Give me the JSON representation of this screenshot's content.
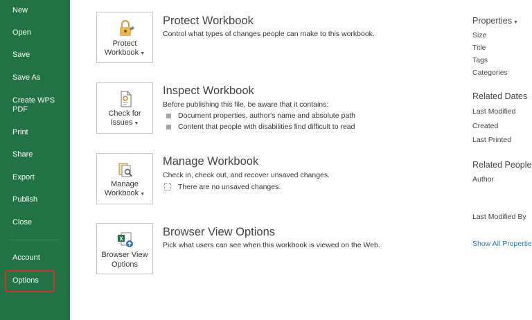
{
  "sidebar": {
    "items": [
      {
        "label": "New"
      },
      {
        "label": "Open"
      },
      {
        "label": "Save"
      },
      {
        "label": "Save As"
      },
      {
        "label": "Create WPS PDF"
      },
      {
        "label": "Print"
      },
      {
        "label": "Share"
      },
      {
        "label": "Export"
      },
      {
        "label": "Publish"
      },
      {
        "label": "Close"
      },
      {
        "label": "Account"
      },
      {
        "label": "Options"
      }
    ],
    "bg_color": "#217346",
    "highlight_color": "#d9302c"
  },
  "sections": {
    "protect": {
      "tile_line1": "Protect",
      "tile_line2": "Workbook",
      "title": "Protect Workbook",
      "desc": "Control what types of changes people can make to this workbook."
    },
    "inspect": {
      "tile_line1": "Check for",
      "tile_line2": "Issues",
      "title": "Inspect Workbook",
      "desc": "Before publishing this file, be aware that it contains:",
      "bullets": [
        "Document properties, author's name and absolute path",
        "Content that people with disabilities find difficult to read"
      ]
    },
    "manage": {
      "tile_line1": "Manage",
      "tile_line2": "Workbook",
      "title": "Manage Workbook",
      "desc": "Check in, check out, and recover unsaved changes.",
      "note": "There are no unsaved changes."
    },
    "browser": {
      "tile_line1": "Browser View",
      "tile_line2": "Options",
      "title": "Browser View Options",
      "desc": "Pick what users can see when this workbook is viewed on the Web."
    }
  },
  "properties": {
    "heading": "Properties",
    "items": [
      "Size",
      "Title",
      "Tags",
      "Categories"
    ],
    "related_dates_heading": "Related Dates",
    "dates": [
      "Last Modified",
      "Created",
      "Last Printed"
    ],
    "related_people_heading": "Related People",
    "people": [
      "Author"
    ],
    "last_modified_by": "Last Modified By",
    "show_all": "Show All Properties"
  },
  "icons": {
    "protect": "lock-icon",
    "inspect": "inspect-document-icon",
    "manage": "manage-workbook-icon",
    "browser": "excel-browser-view-icon"
  }
}
